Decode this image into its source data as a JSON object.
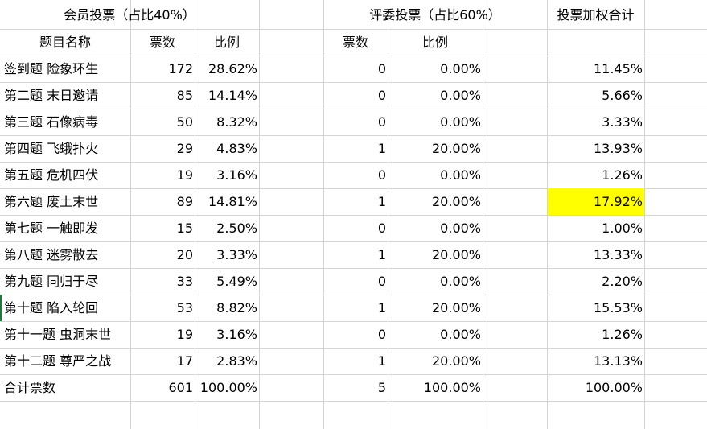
{
  "sheet": {
    "group_headers": {
      "member_vote": "会员投票（占比40%）",
      "judge_vote": "评委投票（占比60%）",
      "weighted_total": "投票加权合计"
    },
    "columns": {
      "title": "题目名称",
      "member_votes": "票数",
      "member_ratio": "比例",
      "judge_votes": "票数",
      "judge_ratio": "比例"
    },
    "rows": [
      {
        "name": "签到题 险象环生",
        "mv": "172",
        "mr": "28.62%",
        "jv": "0",
        "jr": "0.00%",
        "w": "11.45%"
      },
      {
        "name": "第二题 末日邀请",
        "mv": "85",
        "mr": "14.14%",
        "jv": "0",
        "jr": "0.00%",
        "w": "5.66%"
      },
      {
        "name": "第三题 石像病毒",
        "mv": "50",
        "mr": "8.32%",
        "jv": "0",
        "jr": "0.00%",
        "w": "3.33%"
      },
      {
        "name": "第四题 飞蛾扑火",
        "mv": "29",
        "mr": "4.83%",
        "jv": "1",
        "jr": "20.00%",
        "w": "13.93%"
      },
      {
        "name": "第五题 危机四伏",
        "mv": "19",
        "mr": "3.16%",
        "jv": "0",
        "jr": "0.00%",
        "w": "1.26%"
      },
      {
        "name": "第六题  废土末世",
        "mv": "89",
        "mr": "14.81%",
        "jv": "1",
        "jr": "20.00%",
        "w": "17.92%"
      },
      {
        "name": "第七题 一触即发",
        "mv": "15",
        "mr": "2.50%",
        "jv": "0",
        "jr": "0.00%",
        "w": "1.00%"
      },
      {
        "name": "第八题  迷雾散去",
        "mv": "20",
        "mr": "3.33%",
        "jv": "1",
        "jr": "20.00%",
        "w": "13.33%"
      },
      {
        "name": "第九题 同归于尽",
        "mv": "33",
        "mr": "5.49%",
        "jv": "0",
        "jr": "0.00%",
        "w": "2.20%"
      },
      {
        "name": "第十题 陷入轮回",
        "mv": "53",
        "mr": "8.82%",
        "jv": "1",
        "jr": "20.00%",
        "w": "15.53%"
      },
      {
        "name": "第十一题  虫洞末世",
        "mv": "19",
        "mr": "3.16%",
        "jv": "0",
        "jr": "0.00%",
        "w": "1.26%"
      },
      {
        "name": "第十二题 尊严之战",
        "mv": "17",
        "mr": "2.83%",
        "jv": "1",
        "jr": "20.00%",
        "w": "13.13%"
      }
    ],
    "total": {
      "name": "合计票数",
      "mv": "601",
      "mr": "100.00%",
      "jv": "5",
      "jr": "100.00%",
      "w": "100.00%"
    },
    "highlight_color": "#ffff00"
  }
}
